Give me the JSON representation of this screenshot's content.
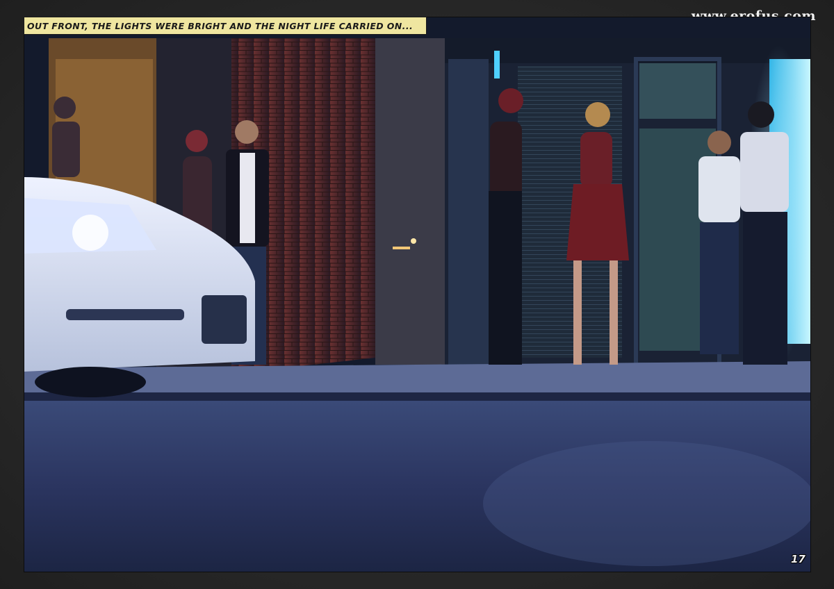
{
  "site": {
    "watermark": "www.erofus.com"
  },
  "panel": {
    "caption": "OUT FRONT, THE LIGHTS WERE BRIGHT AND THE NIGHT LIFE CARRIED ON...",
    "page_number": "17"
  },
  "colors": {
    "caption_bg": "#efe6a0",
    "page_bg": "#2b2b2b",
    "neon": "#7fe8ff",
    "brick": "#5a2a2a"
  }
}
